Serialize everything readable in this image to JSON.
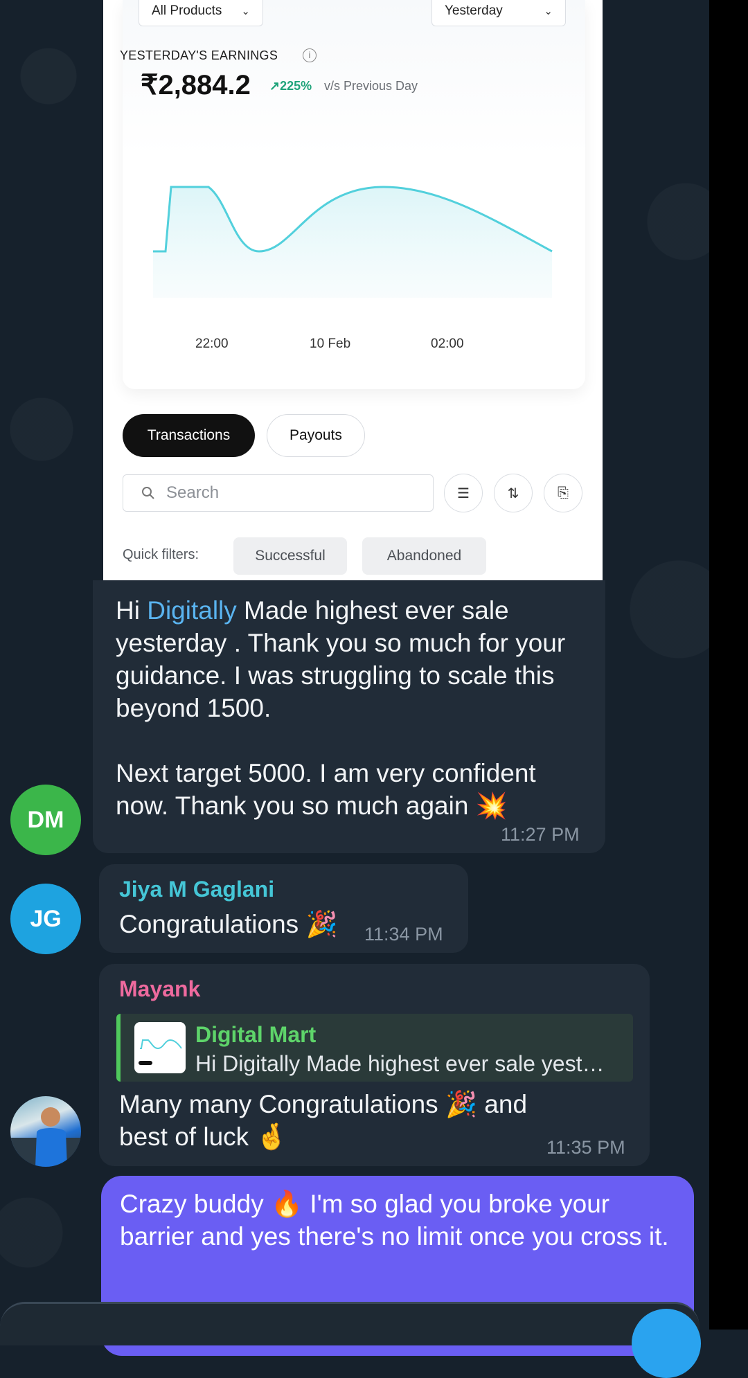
{
  "screenshot": {
    "product_filter": "All Products",
    "period_filter": "Yesterday",
    "earnings_label": "YESTERDAY'S EARNINGS",
    "earnings_value": "₹2,884.2",
    "growth": "↗225%",
    "comparison": "v/s Previous Day",
    "x_ticks": [
      "22:00",
      "10 Feb",
      "02:00"
    ],
    "tab_active": "Transactions",
    "tab_other": "Payouts",
    "search_placeholder": "Search",
    "quick_filters_label": "Quick filters:",
    "quick_filters": [
      "Successful",
      "Abandoned"
    ],
    "line_color": "#52d0dc"
  },
  "messages": [
    {
      "avatar_initials": "DM",
      "avatar_color": "#3bb64a",
      "text_prefix": "Hi ",
      "mention": "Digitally",
      "text_line1": " Made highest ever sale yesterday . Thank you so much for your guidance. I was struggling to scale this beyond 1500.",
      "text_line2": "Next target 5000. I am very confident now. Thank you so much again 💥",
      "time": "11:27 PM"
    },
    {
      "avatar_initials": "JG",
      "avatar_color": "#1ea3e0",
      "sender": "Jiya M Gaglani",
      "sender_color": "#45c6d6",
      "text": "Congratulations 🎉",
      "time": "11:34 PM"
    },
    {
      "sender": "Mayank",
      "sender_color": "#ee6a9e",
      "reply_name": "Digital Mart",
      "reply_text": "Hi Digitally Made highest ever sale yest…",
      "text": "Many many Congratulations 🎉 and best of luck 🤞",
      "time": "11:35 PM"
    },
    {
      "text": "Crazy buddy 🔥 I'm so glad you broke your barrier and yes there's no limit once you cross it."
    }
  ]
}
